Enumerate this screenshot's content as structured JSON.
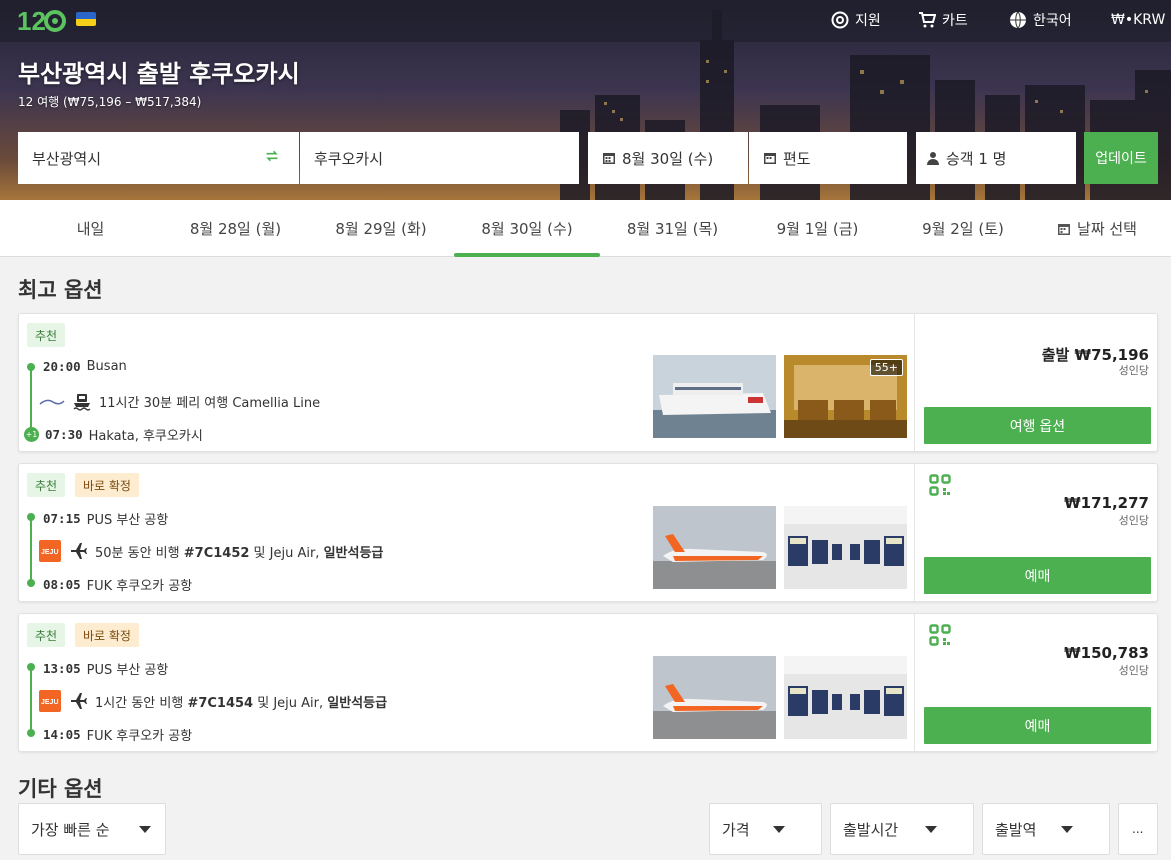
{
  "header": {
    "nav": {
      "support": "지원",
      "cart": "카트",
      "language": "한국어",
      "currency": "₩•KRW"
    },
    "title": "부산광역시 출발 후쿠오카시",
    "subtitle": "12 여행 (₩75,196 – ₩517,384)"
  },
  "search": {
    "from": "부산광역시",
    "to": "후쿠오카시",
    "date": "8월 30일 (수)",
    "trip_type": "편도",
    "passengers": "승객 1 명",
    "update_label": "업데이트"
  },
  "date_tabs": [
    {
      "label": "내일"
    },
    {
      "label": "8월 28일 (월)"
    },
    {
      "label": "8월 29일 (화)"
    },
    {
      "label": "8월 30일 (수)",
      "active": true
    },
    {
      "label": "8월 31일 (목)"
    },
    {
      "label": "9월 1일 (금)"
    },
    {
      "label": "9월 2일 (토)"
    },
    {
      "label": "날짜 선택"
    }
  ],
  "best_title": "최고 옵션",
  "other_title": "기타 옵션",
  "results": [
    {
      "tags": [
        "추천"
      ],
      "dep_time": "20:00",
      "dep_place": "Busan",
      "mid_text": "11시간 30분 페리 여행 Camellia Line",
      "arr_time": "07:30",
      "arr_place": "Hakata, 후쿠오카시",
      "next_day": "+1",
      "photo_badge": "55+",
      "price_label": "출발 ₩75,196",
      "per": "성인당",
      "cta": "여행 옵션"
    },
    {
      "tags": [
        "추천",
        "바로 확정"
      ],
      "dep_time": "07:15",
      "dep_place": "PUS 부산 공항",
      "mid_pre": "50분 동안 비행 ",
      "flight_no": "#7C1452",
      "mid_mid": " 및 Jeju Air, ",
      "cabin": "일반석등급",
      "arr_time": "08:05",
      "arr_place": "FUK 후쿠오카 공항",
      "price_label": "₩171,277",
      "per": "성인당",
      "cta": "예매"
    },
    {
      "tags": [
        "추천",
        "바로 확정"
      ],
      "dep_time": "13:05",
      "dep_place": "PUS 부산 공항",
      "mid_pre": "1시간 동안 비행 ",
      "flight_no": "#7C1454",
      "mid_mid": " 및 Jeju Air, ",
      "cabin": "일반석등급",
      "arr_time": "14:05",
      "arr_place": "FUK 후쿠오카 공항",
      "price_label": "₩150,783",
      "per": "성인당",
      "cta": "예매"
    }
  ],
  "filters": {
    "sort": "가장 빠른 순",
    "price": "가격",
    "departure_time": "출발시간",
    "departure_station": "출발역",
    "more": "..."
  },
  "colors": {
    "accent": "#4caf50",
    "jeju": "#f26522"
  }
}
